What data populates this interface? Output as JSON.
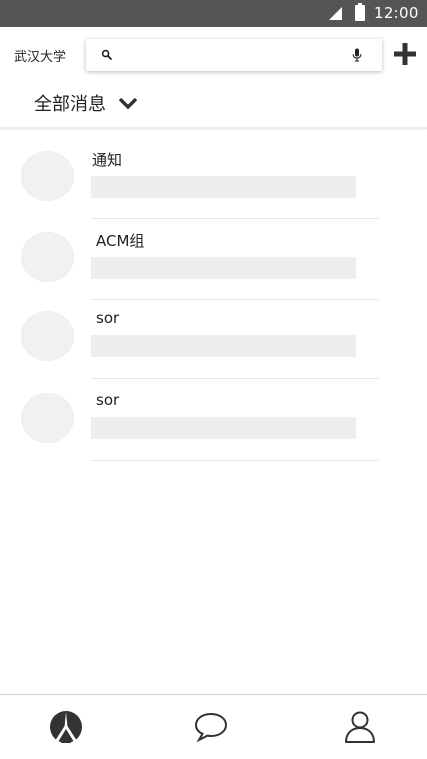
{
  "status_bar": {
    "time": "12:00",
    "signal_icon": "cell-signal-icon",
    "battery_icon": "battery-icon"
  },
  "header": {
    "org_name": "武汉大学",
    "search": {
      "value": "",
      "placeholder": ""
    },
    "filter_label": "全部消息",
    "add_icon": "plus-icon"
  },
  "messages": [
    {
      "title": "通知"
    },
    {
      "title": "ACM组"
    },
    {
      "title": "sor"
    },
    {
      "title": "sor"
    }
  ],
  "bottom_nav": {
    "items": [
      {
        "icon": "university-logo-icon"
      },
      {
        "icon": "chat-bubble-icon"
      },
      {
        "icon": "user-profile-icon"
      }
    ]
  },
  "colors": {
    "status_bar": "#555555",
    "placeholder": "#eeeeee",
    "icon": "#333333"
  }
}
